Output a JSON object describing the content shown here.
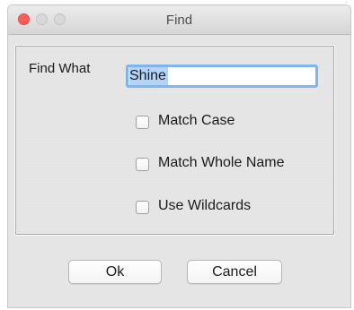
{
  "window": {
    "title": "Find"
  },
  "form": {
    "find_what_label": "Find What",
    "find_what_value": "Shine",
    "checkboxes": [
      {
        "label": "Match Case",
        "checked": false
      },
      {
        "label": "Match Whole Name",
        "checked": false
      },
      {
        "label": "Use Wildcards",
        "checked": false
      }
    ]
  },
  "buttons": {
    "ok_label": "Ok",
    "cancel_label": "Cancel"
  },
  "colors": {
    "close_button": "#fc5f57",
    "focus_ring": "#80b4f0",
    "text_selection": "#b3d4f8"
  }
}
